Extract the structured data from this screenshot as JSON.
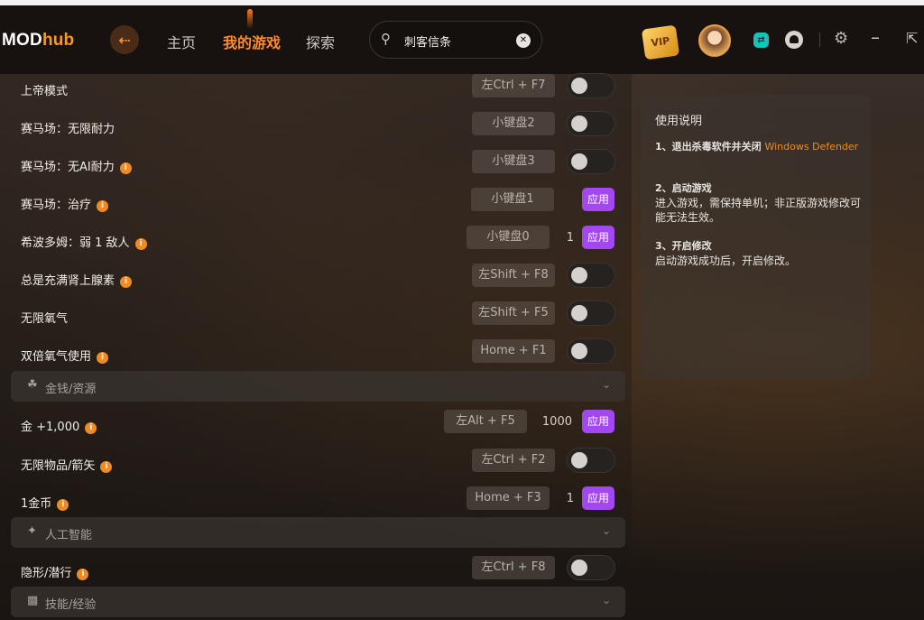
{
  "header": {
    "logo_main": "MOD",
    "logo_accent": "hub",
    "nav": [
      "主页",
      "我的游戏",
      "探索"
    ],
    "search_value": "刺客信条",
    "vip_label": "VIP",
    "accent_color": "#ff8a2a",
    "apply_color": "#a348f0"
  },
  "rows": [
    {
      "label": "上帝模式",
      "hotkey": "左Ctrl + F7",
      "control": "toggle"
    },
    {
      "label": "赛马场：无限耐力",
      "hotkey": "小键盘2",
      "control": "toggle"
    },
    {
      "label": "赛马场：无AI耐力",
      "info": true,
      "hotkey": "小键盘3",
      "control": "toggle"
    },
    {
      "label": "赛马场：治疗",
      "info": true,
      "hotkey": "小键盘1",
      "control": "apply",
      "apply_label": "应用"
    },
    {
      "label": "希波多姆：弱 1 敌人",
      "info": true,
      "hotkey": "小键盘0",
      "control": "apply",
      "value": "1",
      "apply_label": "应用"
    },
    {
      "label": "总是充满肾上腺素",
      "info": true,
      "hotkey": "左Shift + F8",
      "control": "toggle"
    },
    {
      "label": "无限氧气",
      "hotkey": "左Shift + F5",
      "control": "toggle"
    },
    {
      "label": "双倍氧气使用",
      "info": true,
      "hotkey": "Home + F1",
      "control": "toggle"
    }
  ],
  "section_money": {
    "title": "金钱/资源",
    "icon": "money-bag-icon"
  },
  "rows_money": [
    {
      "label": "金 +1,000",
      "info": true,
      "hotkey": "左Alt + F5",
      "control": "apply",
      "value": "1000",
      "apply_label": "应用"
    },
    {
      "label": "无限物品/箭矢",
      "info": true,
      "hotkey": "左Ctrl + F2",
      "control": "toggle"
    },
    {
      "label": "1金币",
      "info": true,
      "hotkey": "Home + F3",
      "control": "apply",
      "value": "1",
      "apply_label": "应用"
    }
  ],
  "section_ai": {
    "title": "人工智能",
    "icon": "ai-icon"
  },
  "rows_ai": [
    {
      "label": "隐形/潜行",
      "info": true,
      "hotkey": "左Ctrl + F8",
      "control": "toggle"
    }
  ],
  "section_skills": {
    "title": "技能/经验",
    "icon": "skills-icon"
  },
  "guide": {
    "title": "使用说明",
    "step1_head": "1、退出杀毒软件并关闭 ",
    "step1_link": "Windows Defender",
    "step2_head": "2、启动游戏",
    "step2_body": "进入游戏，需保持单机；非正版游戏修改可能无法生效。",
    "step3_head": "3、开启修改",
    "step3_body": "启动游戏成功后，开启修改。"
  }
}
